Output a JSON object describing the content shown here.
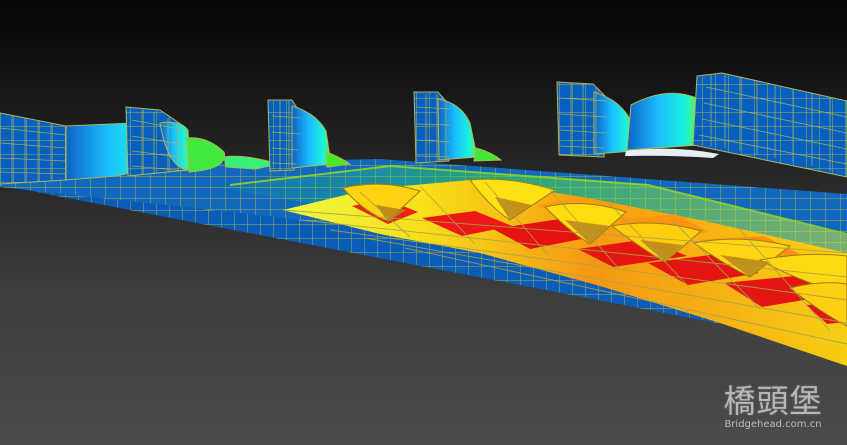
{
  "watermark": {
    "chinese_text": "橋頭堡",
    "url_text": "Bridgehead.com.cn"
  },
  "contour_colors": {
    "blue": "#0b61b5",
    "cyan": "#18d5ff",
    "green": "#44ef2d",
    "yellow": "#ffef12",
    "orange": "#ff9811",
    "red": "#e51612",
    "mesh_line": "#a9b34a"
  }
}
